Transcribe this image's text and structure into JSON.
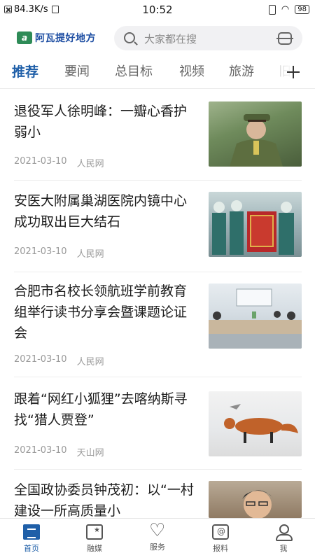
{
  "status_bar": {
    "network_speed": "84.3K/s",
    "time": "10:52",
    "battery": "98"
  },
  "header": {
    "logo_mark": "a",
    "logo_text": "阿瓦提好地方",
    "search_placeholder": "大家都在搜"
  },
  "tabs": [
    {
      "label": "推荐",
      "active": true
    },
    {
      "label": "要闻",
      "active": false
    },
    {
      "label": "总目标",
      "active": false
    },
    {
      "label": "视频",
      "active": false
    },
    {
      "label": "旅游",
      "active": false
    },
    {
      "label": "旧",
      "active": false
    }
  ],
  "articles": [
    {
      "title": "退役军人徐明峰：一瓣心香护弱小",
      "date": "2021-03-10",
      "source": "人民网",
      "thumb": "soldier-portrait"
    },
    {
      "title": "安医大附属巢湖医院内镜中心成功取出巨大结石",
      "date": "2021-03-10",
      "source": "人民网",
      "thumb": "medical-team-banner"
    },
    {
      "title": "合肥市名校长领航班学前教育组举行读书分享会暨课题论证会",
      "date": "2021-03-10",
      "source": "人民网",
      "thumb": "meeting-room"
    },
    {
      "title": "跟着“网红小狐狸”去喀纳斯寻找“猎人贾登”",
      "date": "2021-03-10",
      "source": "天山网",
      "thumb": "fox-in-snow"
    },
    {
      "title": "全国政协委员钟茂初：以“一村建设一所高质量小",
      "date": "",
      "source": "",
      "thumb": "man-portrait"
    }
  ],
  "bottom_nav": [
    {
      "label": "首页",
      "icon": "home-icon",
      "active": true
    },
    {
      "label": "融媒",
      "icon": "media-icon",
      "active": false
    },
    {
      "label": "服务",
      "icon": "service-icon",
      "active": false
    },
    {
      "label": "报料",
      "icon": "report-icon",
      "active": false
    },
    {
      "label": "我",
      "icon": "me-icon",
      "active": false
    }
  ]
}
